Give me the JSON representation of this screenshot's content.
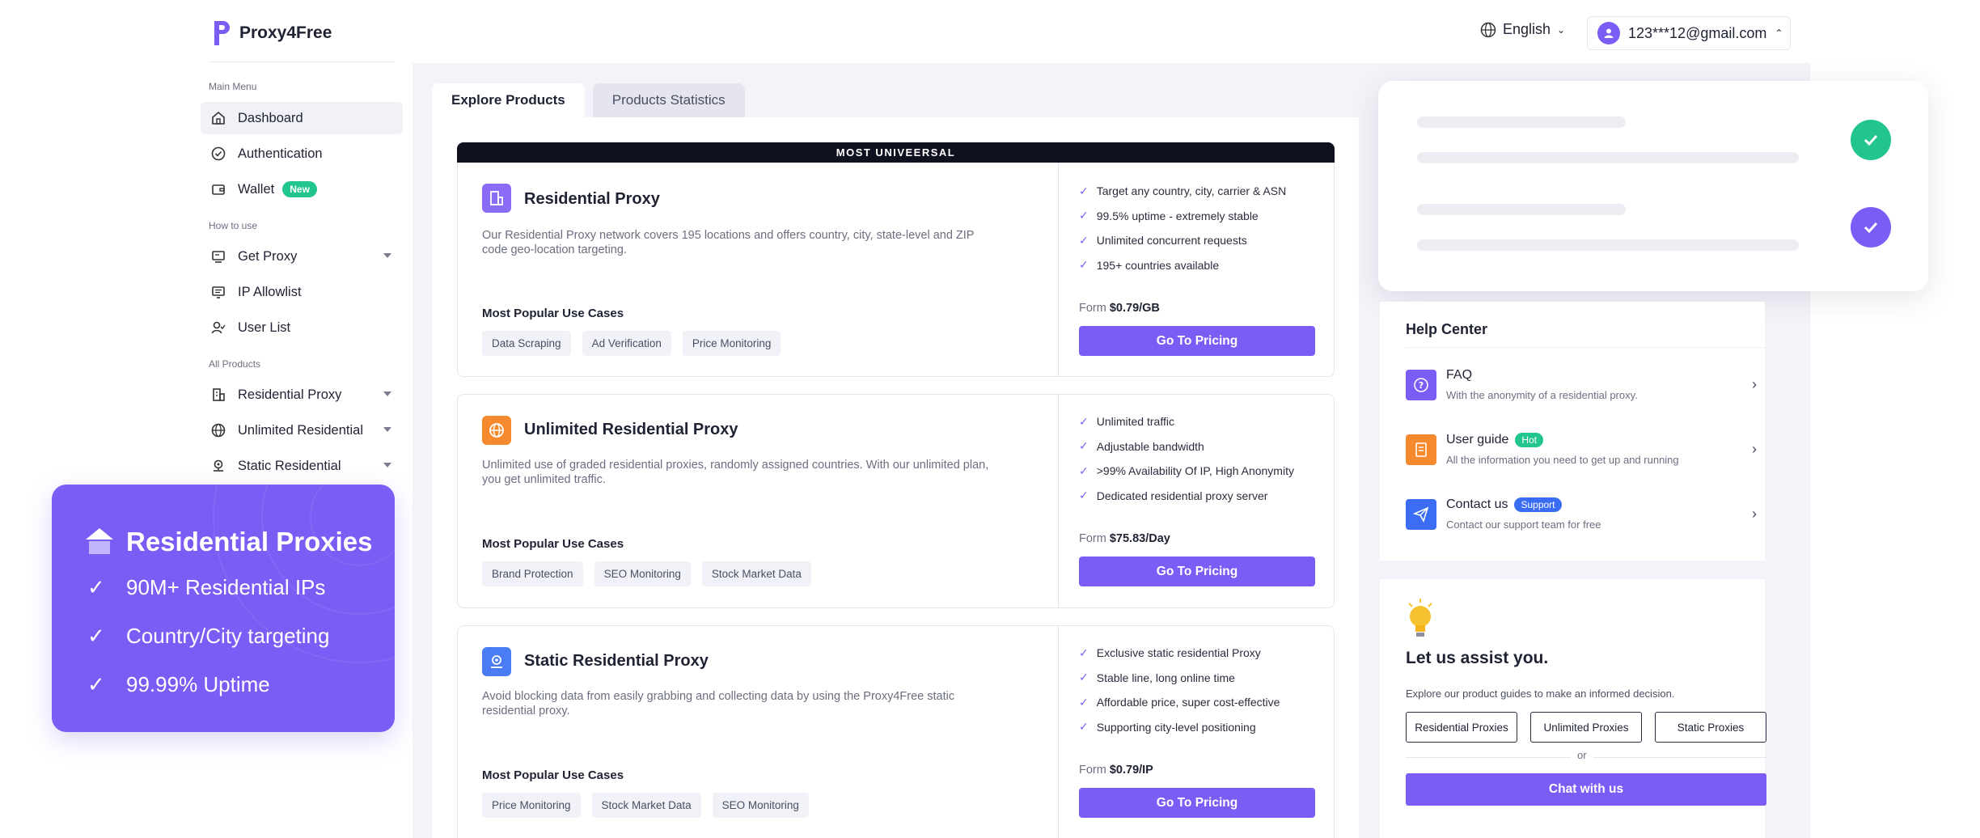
{
  "brand": {
    "name": "Proxy4Free",
    "accent": "#7b5cf5"
  },
  "header": {
    "language": "English",
    "user_email": "123***12@gmail.com"
  },
  "sidebar": {
    "section_main": "Main Menu",
    "section_howto": "How to use",
    "section_products": "All Products",
    "items": [
      {
        "label": "Dashboard"
      },
      {
        "label": "Authentication"
      },
      {
        "label": "Wallet",
        "badge": "New"
      },
      {
        "label": "Get Proxy"
      },
      {
        "label": "IP Allowlist"
      },
      {
        "label": "User List"
      },
      {
        "label": "Residential Proxy"
      },
      {
        "label": "Unlimited Residential"
      },
      {
        "label": "Static Residential"
      }
    ]
  },
  "promo": {
    "title": "Residential Proxies",
    "points": [
      "90M+ Residential IPs",
      "Country/City targeting",
      "99.99% Uptime"
    ]
  },
  "tabs": [
    {
      "label": "Explore Products"
    },
    {
      "label": "Products Statistics"
    }
  ],
  "banner": "MOST UNIVEERSAL",
  "products": [
    {
      "title": "Residential Proxy",
      "desc": "Our Residential Proxy network covers 195 locations and offers country, city, state-level and ZIP code geo-location targeting.",
      "use_cases_label": "Most Popular Use Cases",
      "chips": [
        "Data Scraping",
        "Ad Verification",
        "Price Monitoring"
      ],
      "features": [
        "Target any country, city, carrier & ASN",
        "99.5% uptime - extremely stable",
        "Unlimited concurrent requests",
        "195+ countries available"
      ],
      "price_prefix": "Form",
      "price": "$0.79/GB",
      "button": "Go To Pricing"
    },
    {
      "title": "Unlimited Residential Proxy",
      "desc": "Unlimited use of graded residential proxies, randomly assigned countries. With our unlimited plan, you get unlimited traffic.",
      "use_cases_label": "Most Popular Use Cases",
      "chips": [
        "Brand Protection",
        "SEO Monitoring",
        "Stock Market Data"
      ],
      "features": [
        "Unlimited traffic",
        "Adjustable bandwidth",
        ">99% Availability Of IP, High Anonymity",
        "Dedicated residential proxy server"
      ],
      "price_prefix": "Form",
      "price": "$75.83/Day",
      "button": "Go To Pricing"
    },
    {
      "title": "Static Residential Proxy",
      "desc": "Avoid blocking data from easily grabbing and collecting data by using the Proxy4Free static residential proxy.",
      "use_cases_label": "Most Popular Use Cases",
      "chips": [
        "Price Monitoring",
        "Stock Market Data",
        "SEO Monitoring"
      ],
      "features": [
        "Exclusive static residential Proxy",
        "Stable line, long online time",
        "Affordable price, super cost-effective",
        "Supporting city-level positioning"
      ],
      "price_prefix": "Form",
      "price": "$0.79/IP",
      "button": "Go To Pricing"
    }
  ],
  "help": {
    "title": "Help Center",
    "items": [
      {
        "title": "FAQ",
        "sub": "With the anonymity of a residential proxy."
      },
      {
        "title": "User guide",
        "tag": "Hot",
        "sub": "All the information you need to get up and running"
      },
      {
        "title": "Contact us",
        "tag": "Support",
        "sub": "Contact our support team for free"
      }
    ]
  },
  "assist": {
    "title": "Let us assist you.",
    "sub": "Explore our product guides to make an informed decision.",
    "buttons": [
      "Residential Proxies",
      "Unlimited Proxies",
      "Static Proxies"
    ],
    "or": "or",
    "chat": "Chat with us"
  }
}
